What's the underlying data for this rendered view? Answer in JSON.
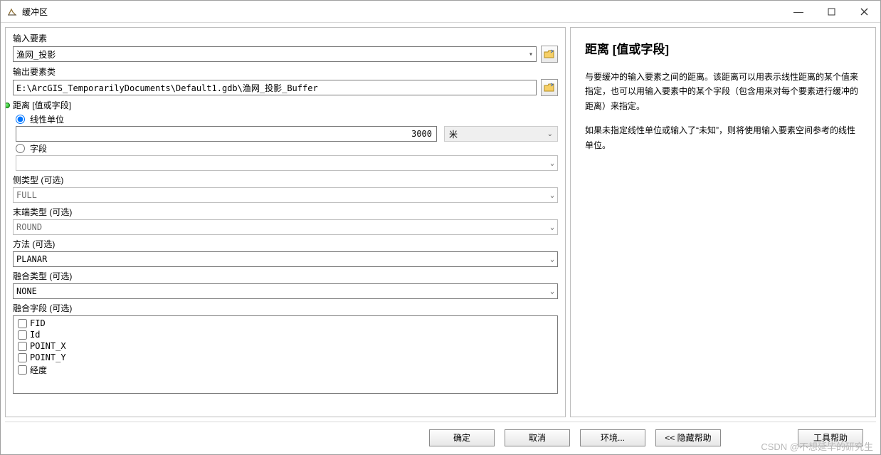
{
  "window": {
    "title": "缓冲区"
  },
  "form": {
    "input_features": {
      "label": "输入要素",
      "value": "渔网_投影"
    },
    "output_fc": {
      "label": "输出要素类",
      "value": "E:\\ArcGIS_TemporarilyDocuments\\Default1.gdb\\渔网_投影_Buffer"
    },
    "distance": {
      "label": "距离 [值或字段]",
      "linear_label": "线性单位",
      "field_label": "字段",
      "value": "3000",
      "unit": "米"
    },
    "side_type": {
      "label": "侧类型 (可选)",
      "value": "FULL"
    },
    "end_type": {
      "label": "末端类型 (可选)",
      "value": "ROUND"
    },
    "method": {
      "label": "方法 (可选)",
      "value": "PLANAR"
    },
    "dissolve_type": {
      "label": "融合类型 (可选)",
      "value": "NONE"
    },
    "dissolve_fields": {
      "label": "融合字段 (可选)",
      "items": [
        "FID",
        "Id",
        "POINT_X",
        "POINT_Y",
        "经度"
      ]
    }
  },
  "buttons": {
    "ok": "确定",
    "cancel": "取消",
    "environments": "环境...",
    "hide_help": "<< 隐藏帮助",
    "tool_help": "工具帮助"
  },
  "help": {
    "title": "距离 [值或字段]",
    "p1": "与要缓冲的输入要素之间的距离。该距离可以用表示线性距离的某个值来指定，也可以用输入要素中的某个字段（包含用来对每个要素进行缓冲的距离）来指定。",
    "p2": "如果未指定线性单位或输入了“未知”，则将使用输入要素空间参考的线性单位。"
  },
  "watermark": "CSDN @不想延毕的研究生"
}
